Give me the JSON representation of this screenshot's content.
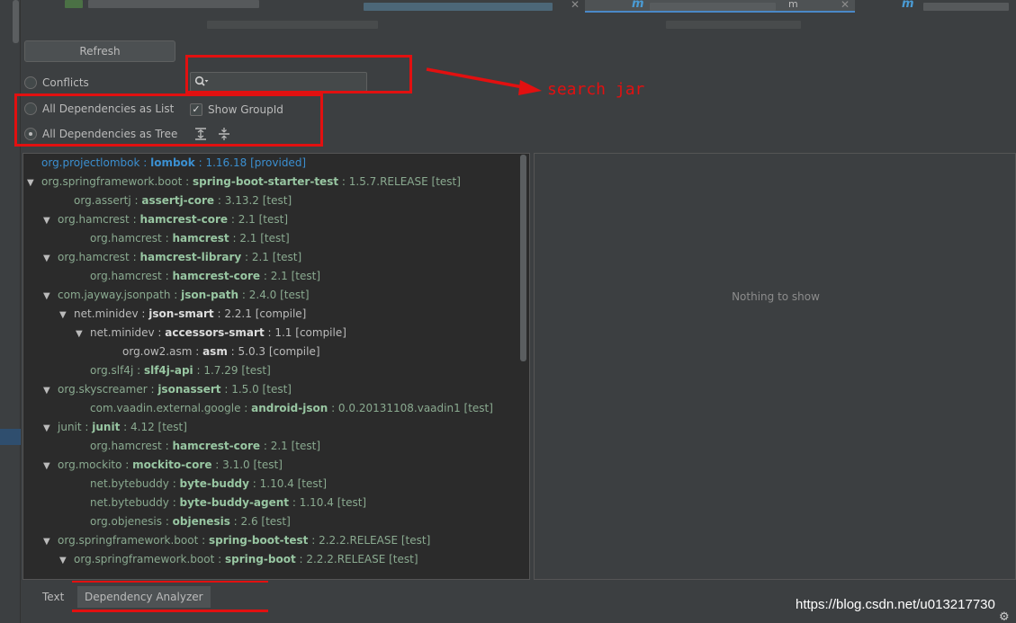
{
  "toolbar": {
    "refresh_label": "Refresh"
  },
  "modes": {
    "conflicts": "Conflicts",
    "list": "All Dependencies as List",
    "tree": "All Dependencies as Tree",
    "show_groupid": "Show GroupId",
    "show_groupid_checked": "✓"
  },
  "search": {
    "value": ""
  },
  "annotation": {
    "text": "search jar"
  },
  "tree": {
    "rows": [
      {
        "toggle": "",
        "group": "org.projectlombok",
        "sep": " : ",
        "artifact": "lombok",
        "version": " : 1.16.18 [provided]"
      },
      {
        "toggle": "▼",
        "group": "org.springframework.boot",
        "sep": " : ",
        "artifact": "spring-boot-starter-test",
        "version": " : 1.5.7.RELEASE [test]"
      },
      {
        "toggle": "",
        "group": "org.assertj",
        "sep": " : ",
        "artifact": "assertj-core",
        "version": " : 3.13.2 [test]"
      },
      {
        "toggle": "▼",
        "group": "org.hamcrest",
        "sep": " : ",
        "artifact": "hamcrest-core",
        "version": " : 2.1 [test]"
      },
      {
        "toggle": "",
        "group": "org.hamcrest",
        "sep": " : ",
        "artifact": "hamcrest",
        "version": " : 2.1 [test]"
      },
      {
        "toggle": "▼",
        "group": "org.hamcrest",
        "sep": " : ",
        "artifact": "hamcrest-library",
        "version": " : 2.1 [test]"
      },
      {
        "toggle": "",
        "group": "org.hamcrest",
        "sep": " : ",
        "artifact": "hamcrest-core",
        "version": " : 2.1 [test]"
      },
      {
        "toggle": "▼",
        "group": "com.jayway.jsonpath",
        "sep": " : ",
        "artifact": "json-path",
        "version": " : 2.4.0 [test]"
      },
      {
        "toggle": "▼",
        "group": "net.minidev",
        "sep": " : ",
        "artifact": "json-smart",
        "version": " : 2.2.1 [compile]"
      },
      {
        "toggle": "▼",
        "group": "net.minidev",
        "sep": " : ",
        "artifact": "accessors-smart",
        "version": " : 1.1 [compile]"
      },
      {
        "toggle": "",
        "group": "org.ow2.asm",
        "sep": " : ",
        "artifact": "asm",
        "version": " : 5.0.3 [compile]"
      },
      {
        "toggle": "",
        "group": "org.slf4j",
        "sep": " : ",
        "artifact": "slf4j-api",
        "version": " : 1.7.29 [test]"
      },
      {
        "toggle": "▼",
        "group": "org.skyscreamer",
        "sep": " : ",
        "artifact": "jsonassert",
        "version": " : 1.5.0 [test]"
      },
      {
        "toggle": "",
        "group": "com.vaadin.external.google",
        "sep": " : ",
        "artifact": "android-json",
        "version": " : 0.0.20131108.vaadin1 [test]"
      },
      {
        "toggle": "▼",
        "group": "junit",
        "sep": " : ",
        "artifact": "junit",
        "version": " : 4.12 [test]"
      },
      {
        "toggle": "",
        "group": "org.hamcrest",
        "sep": " : ",
        "artifact": "hamcrest-core",
        "version": " : 2.1 [test]"
      },
      {
        "toggle": "▼",
        "group": "org.mockito",
        "sep": " : ",
        "artifact": "mockito-core",
        "version": " : 3.1.0 [test]"
      },
      {
        "toggle": "",
        "group": "net.bytebuddy",
        "sep": " : ",
        "artifact": "byte-buddy",
        "version": " : 1.10.4 [test]"
      },
      {
        "toggle": "",
        "group": "net.bytebuddy",
        "sep": " : ",
        "artifact": "byte-buddy-agent",
        "version": " : 1.10.4 [test]"
      },
      {
        "toggle": "",
        "group": "org.objenesis",
        "sep": " : ",
        "artifact": "objenesis",
        "version": " : 2.6 [test]"
      },
      {
        "toggle": "▼",
        "group": "org.springframework.boot",
        "sep": " : ",
        "artifact": "spring-boot-test",
        "version": " : 2.2.2.RELEASE [test]"
      },
      {
        "toggle": "▼",
        "group": "org.springframework.boot",
        "sep": " : ",
        "artifact": "spring-boot",
        "version": " : 2.2.2.RELEASE [test]"
      }
    ]
  },
  "right_panel": {
    "empty_text": "Nothing to show"
  },
  "bottom_tabs": {
    "text": "Text",
    "analyzer": "Dependency Analyzer"
  },
  "editor_tabs": {
    "tab2_suffix": "m",
    "tab_letter": "m"
  },
  "watermark": "https://blog.csdn.net/u013217730",
  "colors": {
    "accent_blue": "#3b8fd0",
    "annotation_red": "#e21010",
    "artifact_green": "#98c6a2"
  }
}
